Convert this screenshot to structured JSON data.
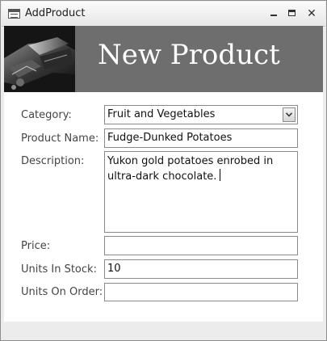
{
  "window": {
    "title": "AddProduct",
    "app_icon": "form-icon",
    "controls": {
      "minimize_icon": "minimize-icon",
      "maximize_icon": "maximize-icon",
      "close_icon": "close-icon"
    }
  },
  "header": {
    "title": "New Product",
    "photo": "chocolate-photo",
    "band_color": "#6e6e6e",
    "title_color": "#ffffff"
  },
  "form": {
    "category": {
      "label": "Category:",
      "value": "Fruit and Vegetables",
      "dropdown_icon": "chevron-down-icon"
    },
    "product_name": {
      "label": "Product Name:",
      "value": "Fudge-Dunked Potatoes"
    },
    "description": {
      "label": "Description:",
      "value": "Yukon gold potatoes enrobed in ultra-dark chocolate."
    },
    "price": {
      "label": "Price:",
      "value": ""
    },
    "units_in_stock": {
      "label": "Units In Stock:",
      "value": "10"
    },
    "units_on_order": {
      "label": "Units On Order:",
      "value": ""
    }
  }
}
